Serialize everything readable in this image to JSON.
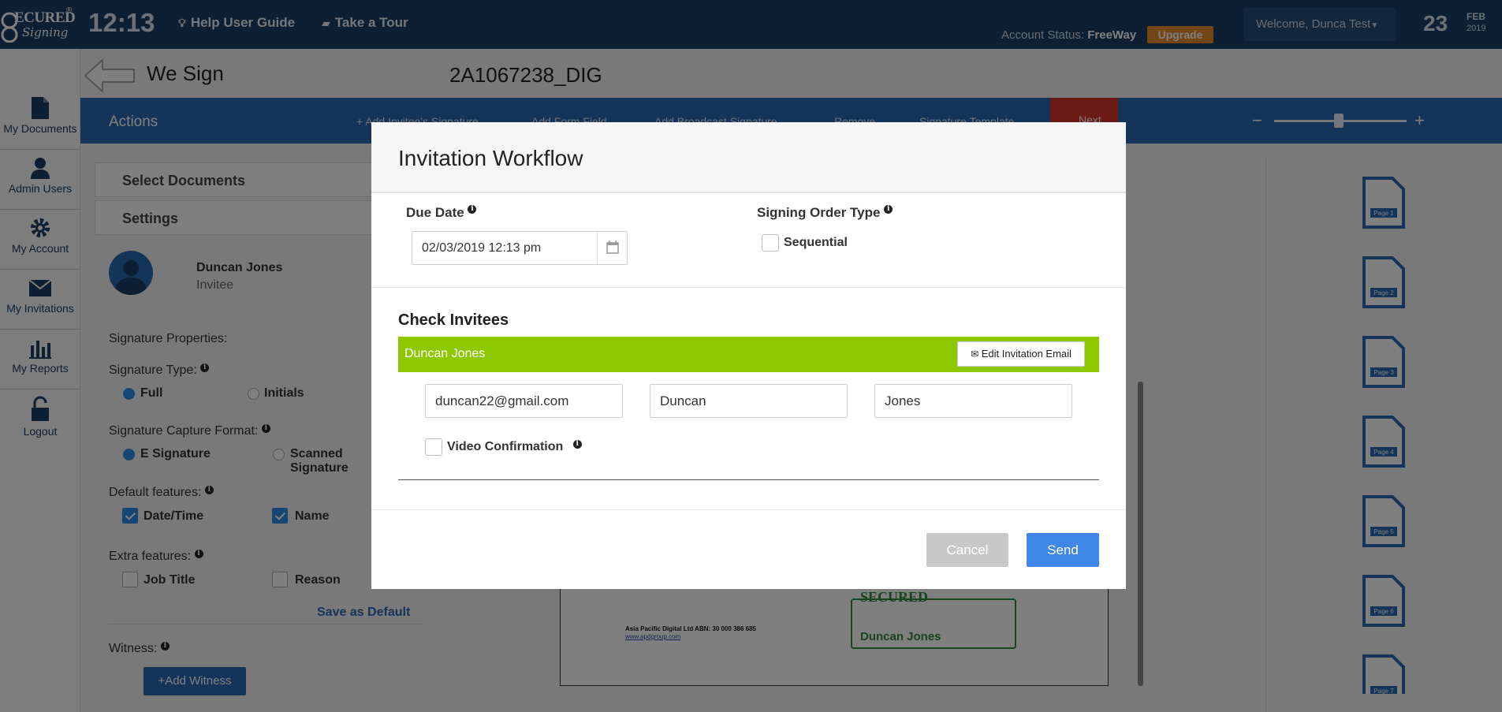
{
  "topbar": {
    "logo_text": "ECURED",
    "logo_script": "Signing",
    "clock": "12:13",
    "help_label": "Help User Guide",
    "tour_label": "Take a Tour",
    "account_status_label": "Account Status:",
    "account_status_value": "FreeWay",
    "upgrade_label": "Upgrade",
    "welcome_label": "Welcome,  Dunca Test",
    "date_day": "23",
    "date_month": "FEB",
    "date_year": "2019"
  },
  "sidebar": {
    "items": [
      {
        "label": "My Documents",
        "icon": "document-icon"
      },
      {
        "label": "Admin Users",
        "icon": "user-icon"
      },
      {
        "label": "My Account",
        "icon": "gear-icon"
      },
      {
        "label": "My Invitations",
        "icon": "envelope-icon"
      },
      {
        "label": "My Reports",
        "icon": "bar-chart-icon"
      },
      {
        "label": "Logout",
        "icon": "lock-icon"
      }
    ]
  },
  "header": {
    "section_title": "We Sign",
    "document_id": "2A1067238_DIG"
  },
  "actionbar": {
    "title": "Actions",
    "items": [
      "+ Add Invitee's Signature",
      "Add Form Field",
      "Add Broadcast Signature",
      "Remove",
      "Signature Template"
    ],
    "next_label": "Next"
  },
  "settings_panel": {
    "select_documents": "Select Documents",
    "settings": "Settings",
    "invitee_name": "Duncan Jones",
    "invitee_role": "Invitee",
    "signature_properties": "Signature Properties:",
    "signature_type_label": "Signature Type:",
    "signature_type_options": [
      "Full",
      "Initials"
    ],
    "capture_format_label": "Signature Capture Format:",
    "capture_format_options": [
      "E Signature",
      "Scanned Signature"
    ],
    "default_features_label": "Default features:",
    "default_features": [
      "Date/Time",
      "Name"
    ],
    "extra_features_label": "Extra features:",
    "extra_features": [
      "Job Title",
      "Reason"
    ],
    "save_default": "Save as Default",
    "witness_label": "Witness:",
    "add_witness": "+Add Witness"
  },
  "pages_column": {
    "pages": [
      "Page 1",
      "Page 2",
      "Page 3",
      "Page 4",
      "Page 5",
      "Page 6",
      "Page 7"
    ]
  },
  "document_preview": {
    "address": "Asia Pacific Digital Ltd ABN: 30 000 386 685",
    "url": "www.apdgroup.com",
    "signature_name": "Duncan Jones",
    "signature_logo": "SECURED"
  },
  "modal": {
    "title": "Invitation Workflow",
    "due_date_label": "Due Date",
    "due_date_value": "02/03/2019 12:13 pm",
    "signing_order_label": "Signing Order Type",
    "sequential_label": "Sequential",
    "check_invitees_label": "Check Invitees",
    "invitee_bar_name": "Duncan Jones",
    "edit_email_label": "Edit Invitation Email",
    "email_value": "duncan22@gmail.com",
    "first_name_value": "Duncan",
    "last_name_value": "Jones",
    "video_confirmation_label": "Video Confirmation",
    "cancel_label": "Cancel",
    "send_label": "Send"
  },
  "colors": {
    "topbar": "#1b3f66",
    "actionbar": "#2b68b2",
    "invitee_bar": "#8dc800",
    "send_button": "#3f86e6",
    "upgrade": "#e98b2a"
  }
}
